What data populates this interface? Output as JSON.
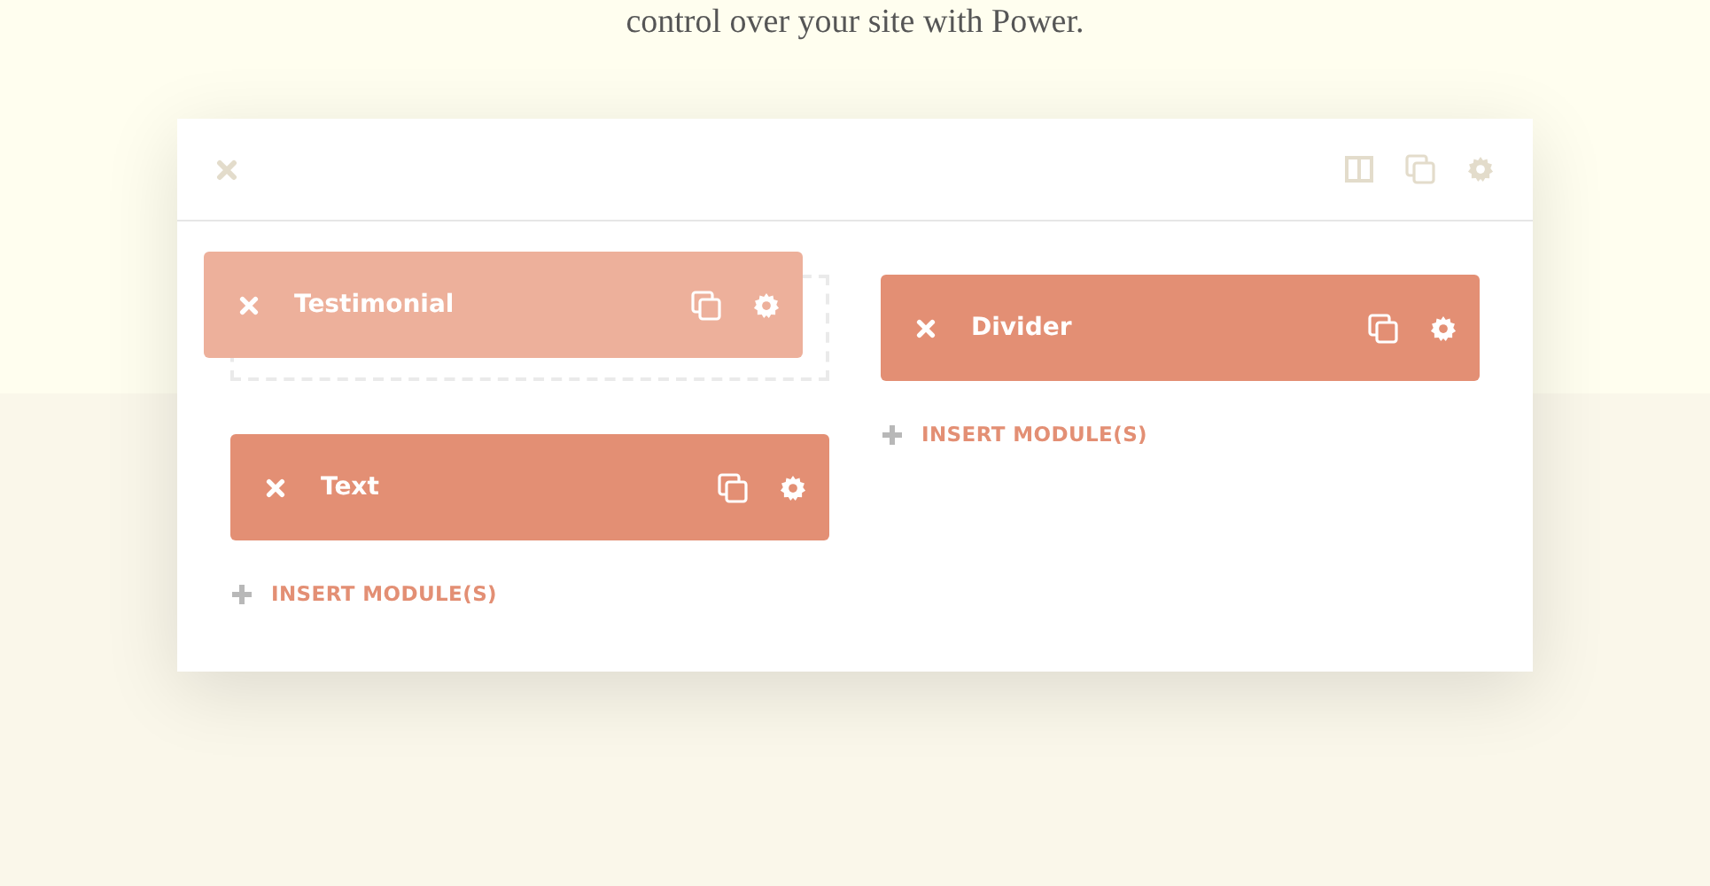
{
  "intro_text": "control over your site with Power.",
  "section": {
    "toolbar_icons": [
      {
        "kind": "columns"
      },
      {
        "kind": "duplicate"
      },
      {
        "kind": "settings"
      }
    ]
  },
  "columns": [
    {
      "modules": [
        {
          "title": "Testimonial",
          "dragging": true
        },
        {
          "title": "Text",
          "dragging": false
        }
      ],
      "insert_label": "INSERT MODULE(S)"
    },
    {
      "modules": [
        {
          "title": "Divider",
          "dragging": false
        }
      ],
      "insert_label": "INSERT MODULE(S)"
    }
  ]
}
